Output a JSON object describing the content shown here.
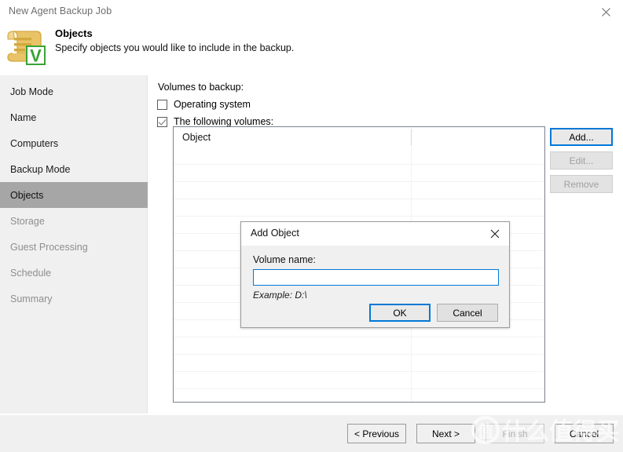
{
  "window": {
    "title": "New Agent Backup Job",
    "close_icon": "close-icon"
  },
  "header": {
    "icon": "veeam-document-icon",
    "title": "Objects",
    "subtitle": "Specify objects you would like to include in the backup."
  },
  "sidebar": {
    "items": [
      {
        "label": "Job Mode",
        "state": "normal"
      },
      {
        "label": "Name",
        "state": "normal"
      },
      {
        "label": "Computers",
        "state": "normal"
      },
      {
        "label": "Backup Mode",
        "state": "normal"
      },
      {
        "label": "Objects",
        "state": "active"
      },
      {
        "label": "Storage",
        "state": "dim"
      },
      {
        "label": "Guest Processing",
        "state": "dim"
      },
      {
        "label": "Schedule",
        "state": "dim"
      },
      {
        "label": "Summary",
        "state": "dim"
      }
    ]
  },
  "content": {
    "volumes_label": "Volumes to backup:",
    "checkboxes": [
      {
        "label": "Operating system",
        "checked": false
      },
      {
        "label": "The following volumes:",
        "checked": true
      }
    ],
    "list": {
      "columns": [
        "Object",
        ""
      ],
      "rows": []
    },
    "side_buttons": [
      {
        "label": "Add...",
        "state": "focused"
      },
      {
        "label": "Edit...",
        "state": "disabled"
      },
      {
        "label": "Remove",
        "state": "disabled"
      }
    ]
  },
  "footer": {
    "buttons": [
      {
        "label": "< Previous",
        "state": "normal"
      },
      {
        "label": "Next >",
        "state": "normal"
      },
      {
        "label": "Finish",
        "state": "disabled"
      },
      {
        "label": "Cancel",
        "state": "normal"
      }
    ]
  },
  "dialog": {
    "title": "Add Object",
    "close_icon": "close-icon",
    "field_label": "Volume name:",
    "field_value": "",
    "field_placeholder": "",
    "example_text": "Example: D:\\",
    "ok_label": "OK",
    "cancel_label": "Cancel"
  },
  "watermark": {
    "text": "什么值得买",
    "badge": "值",
    "color": "#ffffff"
  },
  "colors": {
    "accent": "#0078d7",
    "sidebar_bg": "#f0f0f0",
    "active_item": "#a6a6a6",
    "veeam_green": "#3aa335",
    "veeam_gold": "#e8c05a"
  }
}
